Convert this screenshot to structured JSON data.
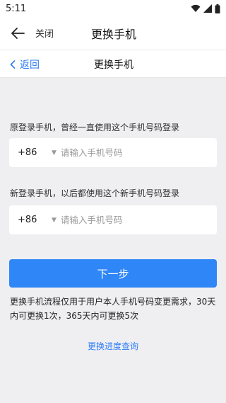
{
  "status_bar": {
    "time": "5:11"
  },
  "app_bar": {
    "close_label": "关闭",
    "title": "更换手机"
  },
  "page_header": {
    "back_label": "返回",
    "title": "更换手机"
  },
  "old_phone": {
    "label": "原登录手机，曾经一直使用这个手机号码登录",
    "country_code": "+86",
    "placeholder": "请输入手机号码",
    "value": ""
  },
  "new_phone": {
    "label": "新登录手机，以后都使用这个新手机号码登录",
    "country_code": "+86",
    "placeholder": "请输入手机号码",
    "value": ""
  },
  "next_button": {
    "label": "下一步"
  },
  "notice": "更换手机流程仅用于用户本人手机号码变更需求，30天内可更换1次，365天内可更换5次",
  "progress_link": "更换进度查询",
  "colors": {
    "accent": "#2f86f6",
    "link": "#2e7cf6",
    "background": "#efeff2"
  },
  "icons": [
    "wifi-icon",
    "cellular-signal-icon",
    "battery-icon",
    "back-arrow-icon",
    "chevron-left-icon",
    "caret-down-icon"
  ]
}
